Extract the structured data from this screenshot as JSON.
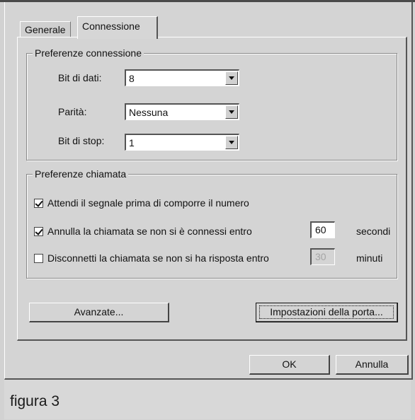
{
  "tabs": [
    {
      "label": "Generale",
      "active": false
    },
    {
      "label": "Connessione",
      "active": true
    }
  ],
  "connection_prefs": {
    "legend": "Preferenze connessione",
    "data_bits": {
      "label": "Bit di dati:",
      "value": "8"
    },
    "parity": {
      "label": "Parità:",
      "value": "Nessuna"
    },
    "stop_bits": {
      "label": "Bit di stop:",
      "value": "1"
    }
  },
  "call_prefs": {
    "legend": "Preferenze chiamata",
    "wait_dial_tone": {
      "label": "Attendi il segnale prima di comporre il numero",
      "checked": true
    },
    "cancel_call": {
      "label": "Annulla la chiamata se non si è connessi entro",
      "checked": true,
      "value": "60",
      "unit": "secondi"
    },
    "disconnect_idle": {
      "label": "Disconnetti la chiamata se non si ha risposta entro",
      "checked": false,
      "value": "30",
      "unit": "minuti",
      "disabled": true
    }
  },
  "buttons": {
    "advanced": "Avanzate...",
    "port_settings": "Impostazioni della porta...",
    "ok": "OK",
    "cancel": "Annulla"
  },
  "caption": "figura 3"
}
